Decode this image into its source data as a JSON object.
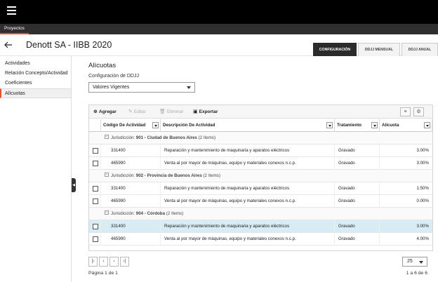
{
  "nav": {
    "tab_label": "Proyectos"
  },
  "header": {
    "title": "Denott SA - IIBB 2020",
    "tabs": [
      {
        "label": "CONFIGURACIÓN",
        "active": true
      },
      {
        "label": "DDJJ MENSUAL",
        "active": false
      },
      {
        "label": "DDJJ ANUAL",
        "active": false
      }
    ]
  },
  "sidebar": {
    "items": [
      {
        "label": "Actividades"
      },
      {
        "label": "Relación Concepto/Actividad"
      },
      {
        "label": "Coeficientes"
      },
      {
        "label": "Alícuotas",
        "active": true
      }
    ]
  },
  "main": {
    "section_title": "Alícuotas",
    "config_label": "Configuración de DDJJ",
    "config_select_value": "Valores Vigentes",
    "toolbar": {
      "add": "Agregar",
      "edit": "Editar",
      "delete": "Eliminar",
      "export": "Exportar"
    },
    "columns": [
      "Código De Actividad",
      "Descripción De Actividad",
      "Tratamiento",
      "Alícuota"
    ],
    "groups": [
      {
        "prefix": "Jurisdicción: ",
        "name": "901 - Ciudad de Buenos Aires",
        "count": " (2 ítems)",
        "rows": [
          {
            "code": "331400",
            "description": "Reparación y mantenimiento de maquinaria y aparatos eléctricos",
            "treatment": "Gravado",
            "rate": "3.00%"
          },
          {
            "code": "465990",
            "description": "Venta al por mayor de máquinas, equipo y materiales conexos n.c.p.",
            "treatment": "Gravado",
            "rate": "3.00%"
          }
        ]
      },
      {
        "prefix": "Jurisdicción: ",
        "name": "902 - Provincia de Buenos Aires",
        "count": " (2 ítems)",
        "rows": [
          {
            "code": "331400",
            "description": "Reparación y mantenimiento de maquinaria y aparatos eléctricos",
            "treatment": "Gravado",
            "rate": "1.50%"
          },
          {
            "code": "465990",
            "description": "Venta al por mayor de máquinas, equipo y materiales conexos n.c.p.",
            "treatment": "Gravado",
            "rate": "0.00%"
          }
        ]
      },
      {
        "prefix": "Jurisdicción: ",
        "name": "904 - Córdoba",
        "count": " (2 ítems)",
        "rows": [
          {
            "code": "331400",
            "description": "Reparación y mantenimiento de maquinaria y aparatos eléctricos",
            "treatment": "Gravado",
            "rate": "3.00%",
            "selected": true
          },
          {
            "code": "465990",
            "description": "Venta al por mayor de máquinas, equipo y materiales conexos n.c.p.",
            "treatment": "Gravado",
            "rate": "4.00%"
          }
        ]
      }
    ],
    "pager": {
      "page_size": "25",
      "page_info": "Página 1 de 1",
      "range_info": "1 a 6 de 6"
    }
  },
  "colors": {
    "accent": "#e8522a",
    "selected_row": "#d8ecf3",
    "dark_tab": "#2b2b2b"
  },
  "icons": [
    "hamburger-menu-icon",
    "back-arrow-icon",
    "add-icon",
    "edit-icon",
    "delete-icon",
    "export-icon",
    "columns-icon",
    "gear-icon",
    "collapse-icon",
    "first-page-icon",
    "prev-page-icon",
    "next-page-icon",
    "last-page-icon"
  ]
}
